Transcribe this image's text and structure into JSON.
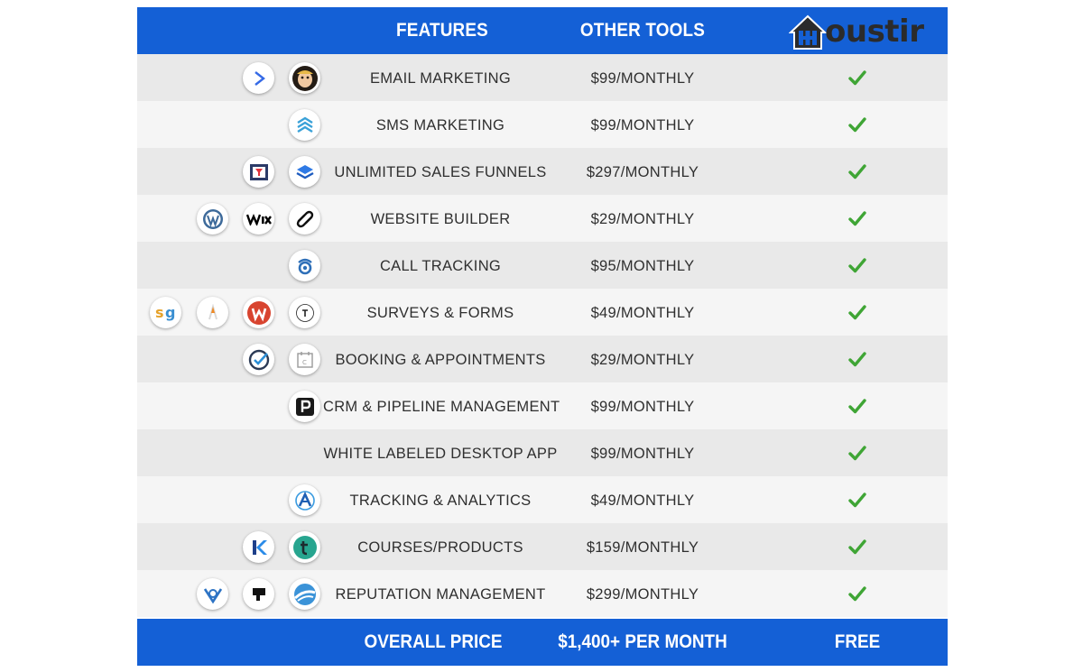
{
  "header": {
    "features_label": "FEATURES",
    "other_tools_label": "OTHER TOOLS",
    "brand_text": "oustir"
  },
  "rows": [
    {
      "feature": "EMAIL MARKETING",
      "price": "$99/MONTHLY",
      "icons": [
        "activecampaign-icon",
        "mailchimp-icon"
      ]
    },
    {
      "feature": "SMS MARKETING",
      "price": "$99/MONTHLY",
      "icons": [
        "layers-chevron-icon"
      ]
    },
    {
      "feature": "UNLIMITED SALES FUNNELS",
      "price": "$297/MONTHLY",
      "icons": [
        "clickfunnels-icon",
        "leadpages-icon"
      ]
    },
    {
      "feature": "WEBSITE BUILDER",
      "price": "$29/MONTHLY",
      "icons": [
        "wordpress-icon",
        "wix-icon",
        "squarespace-icon"
      ]
    },
    {
      "feature": "CALL TRACKING",
      "price": "$95/MONTHLY",
      "icons": [
        "callrail-icon"
      ]
    },
    {
      "feature": "SURVEYS & FORMS",
      "price": "$49/MONTHLY",
      "icons": [
        "surveygizmo-icon",
        "pencil-icon",
        "wufoo-icon",
        "typeform-icon"
      ]
    },
    {
      "feature": "BOOKING & APPOINTMENTS",
      "price": "$29/MONTHLY",
      "icons": [
        "check-circle-icon",
        "calendar-icon"
      ]
    },
    {
      "feature": "CRM & PIPELINE MANAGEMENT",
      "price": "$99/MONTHLY",
      "icons": [
        "pipedrive-icon"
      ]
    },
    {
      "feature": "WHITE LABELED DESKTOP APP",
      "price": "$99/MONTHLY",
      "icons": []
    },
    {
      "feature": "TRACKING & ANALYTICS",
      "price": "$49/MONTHLY",
      "icons": [
        "analytics-icon"
      ]
    },
    {
      "feature": "COURSES/PRODUCTS",
      "price": "$159/MONTHLY",
      "icons": [
        "kajabi-icon",
        "teachable-icon"
      ]
    },
    {
      "feature": "REPUTATION MANAGEMENT",
      "price": "$299/MONTHLY",
      "icons": [
        "birdeye-icon",
        "podium-icon",
        "swell-icon"
      ]
    }
  ],
  "footer": {
    "label": "OVERALL PRICE",
    "other_total": "$1,400+ PER MONTH",
    "houstir_total": "FREE"
  },
  "colors": {
    "brand_blue": "#1460d6",
    "check_green": "#3fa535",
    "row_shade": "#e9e9e9",
    "row_light": "#f5f5f5"
  }
}
